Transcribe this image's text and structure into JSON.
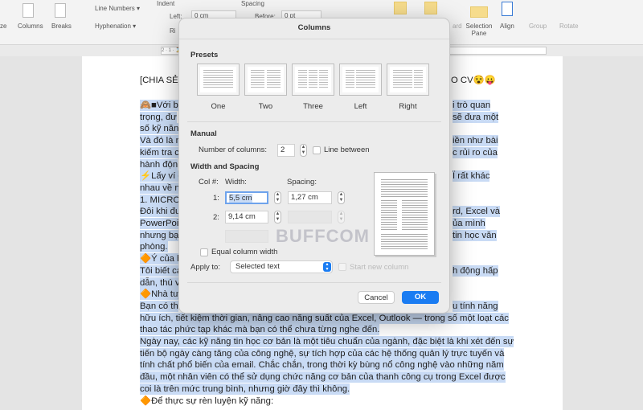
{
  "toolbar": {
    "size": "ze",
    "columns": "Columns",
    "breaks": "Breaks",
    "line_numbers": "Line Numbers ▾",
    "hyphenation": "Hyphenation ▾",
    "indent": "Indent",
    "left_label": "Left:",
    "left_value": "0 cm",
    "right_label": "Ri",
    "spacing": "Spacing",
    "before_label": "Before:",
    "before_value": "0 pt",
    "forward": "ard",
    "selection_pane": "Selection Pane",
    "align": "Align",
    "group": "Group",
    "rotate": "Rotate"
  },
  "ruler": {
    "ticks": "2 · 1 · ⌛ · 1 · · · · · · · · · · · · · · · · · · · · · · · · · · · · · · · · · 14 · 15 · 16 · 17 · 18"
  },
  "document": {
    "title_left": "[CHIA SẺ]",
    "title_right": "O CV😵😛",
    "lines": [
      {
        "l": "🙈■Với b",
        "r": "i trò quan"
      },
      {
        "l": "trọng, đư",
        "r": "sẽ đưa một"
      },
      {
        "l": "số kỹ năn",
        "r": ""
      },
      {
        "l": "Và đó là n",
        "r": "iền như bài"
      },
      {
        "l": "kiếm tra c",
        "r": "c rủi ro của"
      },
      {
        "l": "hành độn",
        "r": ""
      },
      {
        "l": "⚡Lấy ví dụ",
        "r": "Ï rất khác"
      },
      {
        "l": "nhau về n",
        "r": ""
      },
      {
        "l": "1. MICRO",
        "r": ""
      },
      {
        "l": "Đôi khi đư",
        "r": "rd, Excel và"
      },
      {
        "l": "PowerPoi",
        "r": "ủa mình"
      },
      {
        "l": "nhưng bạ",
        "r": "tin học văn"
      },
      {
        "l": "phòng.",
        "r": ""
      },
      {
        "l": "🔶Ý của b",
        "r": ""
      },
      {
        "l": "Tôi biết ca",
        "r": "h động hấp"
      },
      {
        "l": "dẫn, thú v",
        "r": ""
      },
      {
        "l": "🔶Nhà tuy",
        "r": ""
      },
      {
        "l": "Bạn có th",
        "r": "u tính năng"
      },
      {
        "l": "hữu ích, tiết kiệm thời gian, nâng cao năng suất của Excel, Outlook — trong số một loạt các",
        "r": ""
      },
      {
        "l": "thao tác phức tạp khác mà bạn có thể chưa từng nghe đến.",
        "r": ""
      },
      {
        "l": "Ngày nay, các kỹ năng tin học cơ bản là một tiêu chuẩn của ngành, đặc biệt là khi xét đến sự",
        "r": ""
      },
      {
        "l": "tiến bộ ngày càng tăng của công nghệ, sự tích hợp của các hệ thống quản lý trực tuyến và",
        "r": ""
      },
      {
        "l": "tính chất phổ biến của email. Chắc chắn, trong thời kỳ bùng nổ công nghệ vào những năm",
        "r": ""
      },
      {
        "l": "đầu, một nhân viên có thể sử dụng chức năng cơ bản của thanh công cụ trong Excel được",
        "r": ""
      },
      {
        "l": "coi là trên mức trung bình, nhưng giờ đây thì không.",
        "r": ""
      },
      {
        "l": "🔶Để thực sự rèn luyện kỹ năng:",
        "r": ""
      }
    ]
  },
  "dialog": {
    "title": "Columns",
    "presets_heading": "Presets",
    "presets": [
      "One",
      "Two",
      "Three",
      "Left",
      "Right"
    ],
    "manual_heading": "Manual",
    "num_columns_label": "Number of columns:",
    "num_columns": "2",
    "line_between": "Line between",
    "ws_heading": "Width and Spacing",
    "col_label": "Col #:",
    "width_label": "Width:",
    "spacing_label": "Spacing:",
    "rows": [
      {
        "n": "1:",
        "width": "5,5 cm",
        "spacing": "1,27 cm"
      },
      {
        "n": "2:",
        "width": "9,14 cm",
        "spacing": ""
      }
    ],
    "equal_width": "Equal column width",
    "apply_label": "Apply to:",
    "apply_value": "Selected text",
    "start_new": "Start new column",
    "cancel": "Cancel",
    "ok": "OK"
  },
  "watermark": "BUFFCOM",
  "colors": {
    "accent": "#1a7cf2",
    "selection": "#c9dbf5"
  }
}
